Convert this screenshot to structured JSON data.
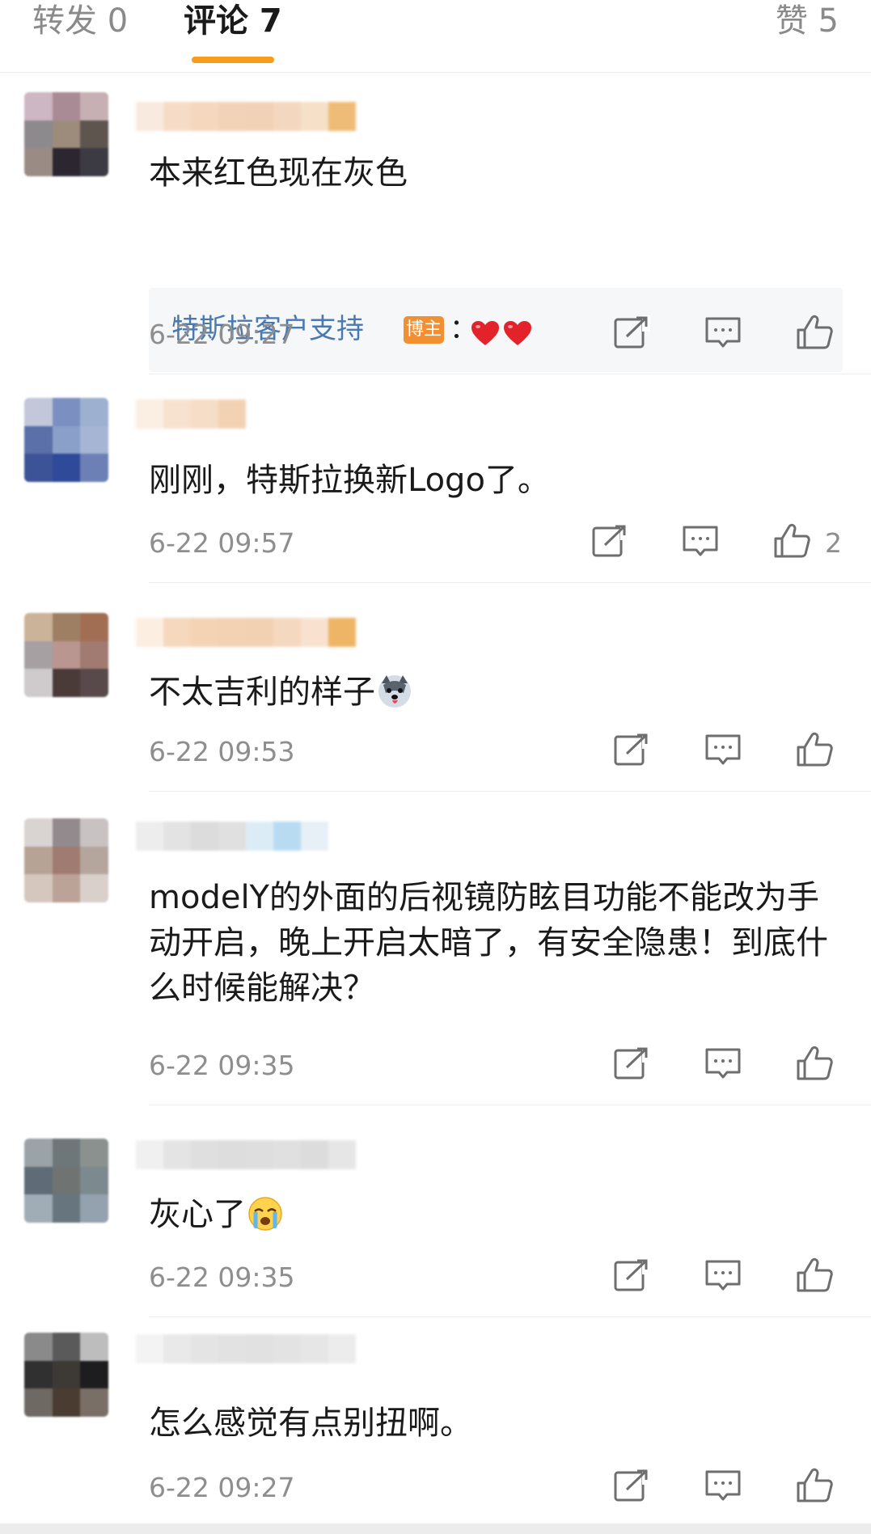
{
  "tabs": {
    "forward": "转发 0",
    "comment": "评论 7",
    "like": "赞 5"
  },
  "accent_color": "#f79c1c",
  "icons": {
    "share": "share-icon",
    "reply": "comment-icon",
    "like": "thumbs-up-icon"
  },
  "comments": [
    {
      "text": "本来红色现在灰色",
      "time": "6-22 09:27",
      "reply": {
        "author": "特斯拉客户支持",
        "badge": "博主",
        "colon": "：",
        "emoji": "heart-emoji x2"
      }
    },
    {
      "text": "刚刚，特斯拉换新Logo了。",
      "time": "6-22 09:57",
      "likes": "2"
    },
    {
      "text": "不太吉利的样子",
      "emoji": "husky-emoji",
      "time": "6-22 09:53"
    },
    {
      "text": "modelY的外面的后视镜防眩目功能不能改为手动开启，晚上开启太暗了，有安全隐患！到底什么时候能解决？",
      "time": "6-22 09:35"
    },
    {
      "text": "灰心了",
      "emoji": "crying-emoji",
      "time": "6-22 09:35"
    },
    {
      "text": "怎么感觉有点别扭啊。",
      "time": "6-22 09:27"
    }
  ]
}
